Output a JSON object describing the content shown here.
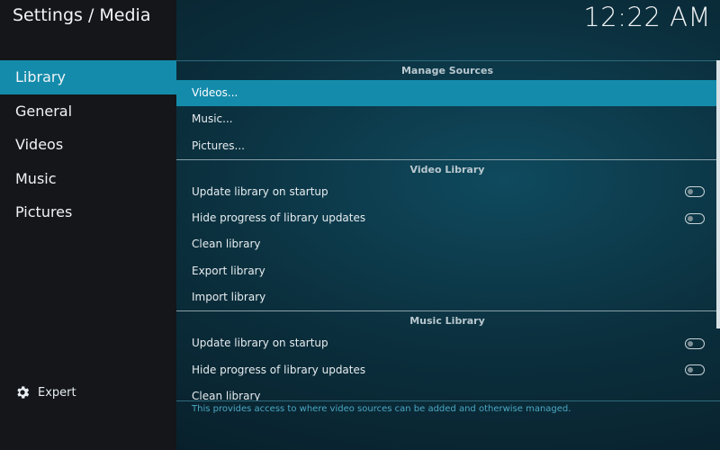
{
  "header": {
    "title": "Settings / Media",
    "clock": "12:22 AM"
  },
  "categories": [
    {
      "label": "Library",
      "active": true
    },
    {
      "label": "General",
      "active": false
    },
    {
      "label": "Videos",
      "active": false
    },
    {
      "label": "Music",
      "active": false
    },
    {
      "label": "Pictures",
      "active": false
    }
  ],
  "settings_level": {
    "label": "Expert",
    "icon": "gear-icon"
  },
  "groups": {
    "manage_sources": {
      "title": "Manage Sources",
      "items": [
        "Videos...",
        "Music...",
        "Pictures..."
      ]
    },
    "video_library": {
      "title": "Video Library",
      "items": [
        {
          "label": "Update library on startup",
          "toggle": "off"
        },
        {
          "label": "Hide progress of library updates",
          "toggle": "off"
        },
        {
          "label": "Clean library"
        },
        {
          "label": "Export library"
        },
        {
          "label": "Import library"
        }
      ]
    },
    "music_library": {
      "title": "Music Library",
      "items": [
        {
          "label": "Update library on startup",
          "toggle": "off"
        },
        {
          "label": "Hide progress of library updates",
          "toggle": "off"
        },
        {
          "label": "Clean library"
        }
      ]
    }
  },
  "description": "This provides access to where video sources can be added and otherwise managed.",
  "colors": {
    "accent": "#148bab",
    "description_text": "#4aa8c4"
  }
}
